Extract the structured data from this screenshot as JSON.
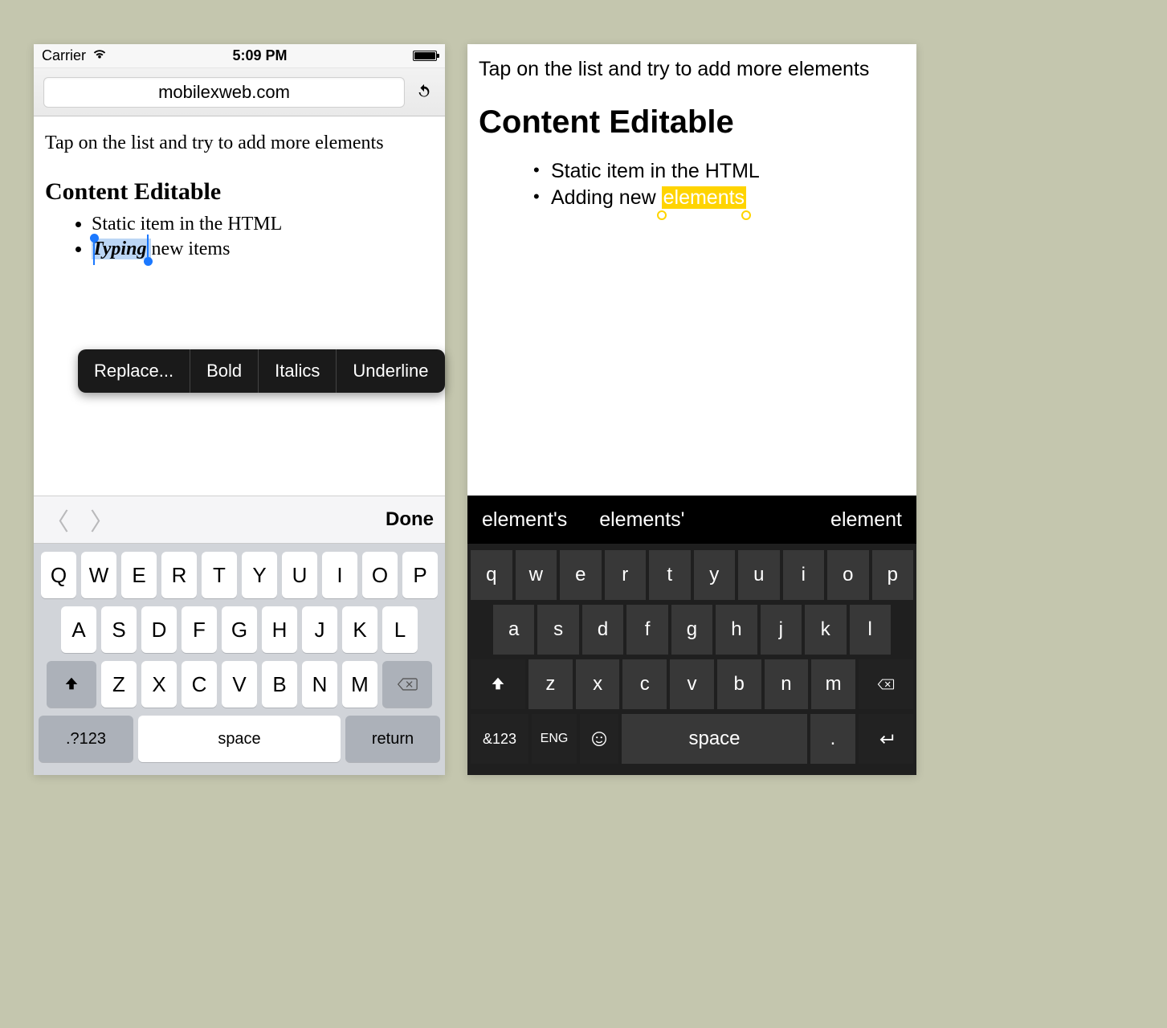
{
  "ios": {
    "status": {
      "carrier": "Carrier",
      "time": "5:09 PM"
    },
    "url": "mobilexweb.com",
    "instruction": "Tap on the list and try to add more elements",
    "heading": "Content Editable",
    "list": {
      "item1": "Static item in the HTML",
      "item2_selected": "Typing",
      "item2_rest": " new items"
    },
    "menu": {
      "replace": "Replace...",
      "bold": "Bold",
      "italics": "Italics",
      "underline": "Underline"
    },
    "accessory": {
      "done": "Done"
    },
    "keyboard": {
      "row1": [
        "Q",
        "W",
        "E",
        "R",
        "T",
        "Y",
        "U",
        "I",
        "O",
        "P"
      ],
      "row2": [
        "A",
        "S",
        "D",
        "F",
        "G",
        "H",
        "J",
        "K",
        "L"
      ],
      "row3": [
        "Z",
        "X",
        "C",
        "V",
        "B",
        "N",
        "M"
      ],
      "fn": ".?123",
      "space": "space",
      "ret": "return"
    }
  },
  "wp": {
    "instruction": "Tap on the list and try to add more elements",
    "heading": "Content Editable",
    "list": {
      "item1": "Static item in the HTML",
      "item2_pre": "Adding new ",
      "item2_sel": "elements"
    },
    "suggestions": [
      "element's",
      "elements'",
      "element"
    ],
    "keyboard": {
      "row1": [
        "q",
        "w",
        "e",
        "r",
        "t",
        "y",
        "u",
        "i",
        "o",
        "p"
      ],
      "row2": [
        "a",
        "s",
        "d",
        "f",
        "g",
        "h",
        "j",
        "k",
        "l"
      ],
      "row3": [
        "z",
        "x",
        "c",
        "v",
        "b",
        "n",
        "m"
      ],
      "fn": "&123",
      "lang": "ENG",
      "space": "space",
      "dot": "."
    }
  }
}
